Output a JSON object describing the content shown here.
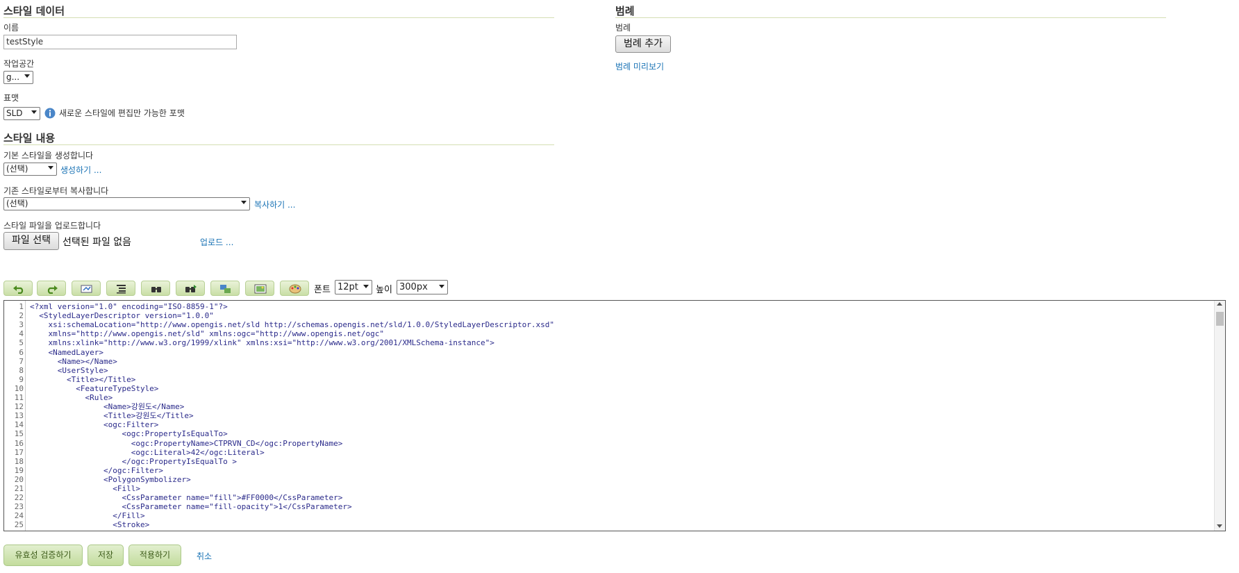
{
  "style_data": {
    "title": "스타일 데이터",
    "name_label": "이름",
    "name_value": "testStyle",
    "workspace_label": "작업공간",
    "workspace_value": "g...",
    "format_label": "표맷",
    "format_value": "SLD",
    "format_note": "새로운 스타일에 편집만 가능한 포맷"
  },
  "legend": {
    "title": "범례",
    "label": "범례",
    "add_button": "범례 추가",
    "preview_link": "범례 미리보기"
  },
  "style_content": {
    "title": "스타일 내용",
    "default_label": "기본 스타일을 생성합니다",
    "default_select": "(선택)",
    "generate_link": "생성하기 ...",
    "copy_label": "기존 스타일로부터 복사합니다",
    "copy_select": "(선택)",
    "copy_link": "복사하기 ...",
    "upload_label": "스타일 파일을 업로드합니다",
    "file_button": "파일 선택",
    "file_status": "선택된 파일 없음",
    "upload_link": "업로드 ..."
  },
  "toolbar": {
    "font_label": "폰트",
    "font_value": "12pt",
    "height_label": "높이",
    "height_value": "300px",
    "icons": [
      "undo-icon",
      "redo-icon",
      "go-to-line-icon",
      "reformat-icon",
      "find-icon",
      "find-replace-icon",
      "replace-all-icon",
      "image-icon",
      "color-palette-icon"
    ]
  },
  "editor": {
    "line_numbers": [
      "1",
      "2",
      "3",
      "4",
      "5",
      "6",
      "7",
      "8",
      "9",
      "10",
      "11",
      "12",
      "13",
      "14",
      "15",
      "16",
      "17",
      "18",
      "19",
      "20",
      "21",
      "22",
      "23",
      "24",
      "25"
    ],
    "lines": [
      "<?xml version=\"1.0\" encoding=\"ISO-8859-1\"?>",
      "  <StyledLayerDescriptor version=\"1.0.0\"",
      "    xsi:schemaLocation=\"http://www.opengis.net/sld http://schemas.opengis.net/sld/1.0.0/StyledLayerDescriptor.xsd\"",
      "    xmlns=\"http://www.opengis.net/sld\" xmlns:ogc=\"http://www.opengis.net/ogc\"",
      "    xmlns:xlink=\"http://www.w3.org/1999/xlink\" xmlns:xsi=\"http://www.w3.org/2001/XMLSchema-instance\">",
      "    <NamedLayer>",
      "      <Name></Name>",
      "      <UserStyle>",
      "        <Title></Title>",
      "          <FeatureTypeStyle>",
      "            <Rule>",
      "                <Name>강원도</Name>",
      "                <Title>강원도</Title>",
      "                <ogc:Filter>",
      "                    <ogc:PropertyIsEqualTo>",
      "                      <ogc:PropertyName>CTPRVN_CD</ogc:PropertyName>",
      "                      <ogc:Literal>42</ogc:Literal>",
      "                    </ogc:PropertyIsEqualTo >",
      "                </ogc:Filter>",
      "                <PolygonSymbolizer>",
      "                  <Fill>",
      "                    <CssParameter name=\"fill\">#FF0000</CssParameter>",
      "                    <CssParameter name=\"fill-opacity\">1</CssParameter>",
      "                  </Fill>",
      "                  <Stroke>"
    ]
  },
  "actions": {
    "validate": "유효성 검증하기",
    "save": "저장",
    "apply": "적용하기",
    "cancel": "취소"
  },
  "colors": {
    "accent_green": "#c3dc9d",
    "link_blue": "#1a73b5",
    "rule_line": "#d4deb3"
  }
}
